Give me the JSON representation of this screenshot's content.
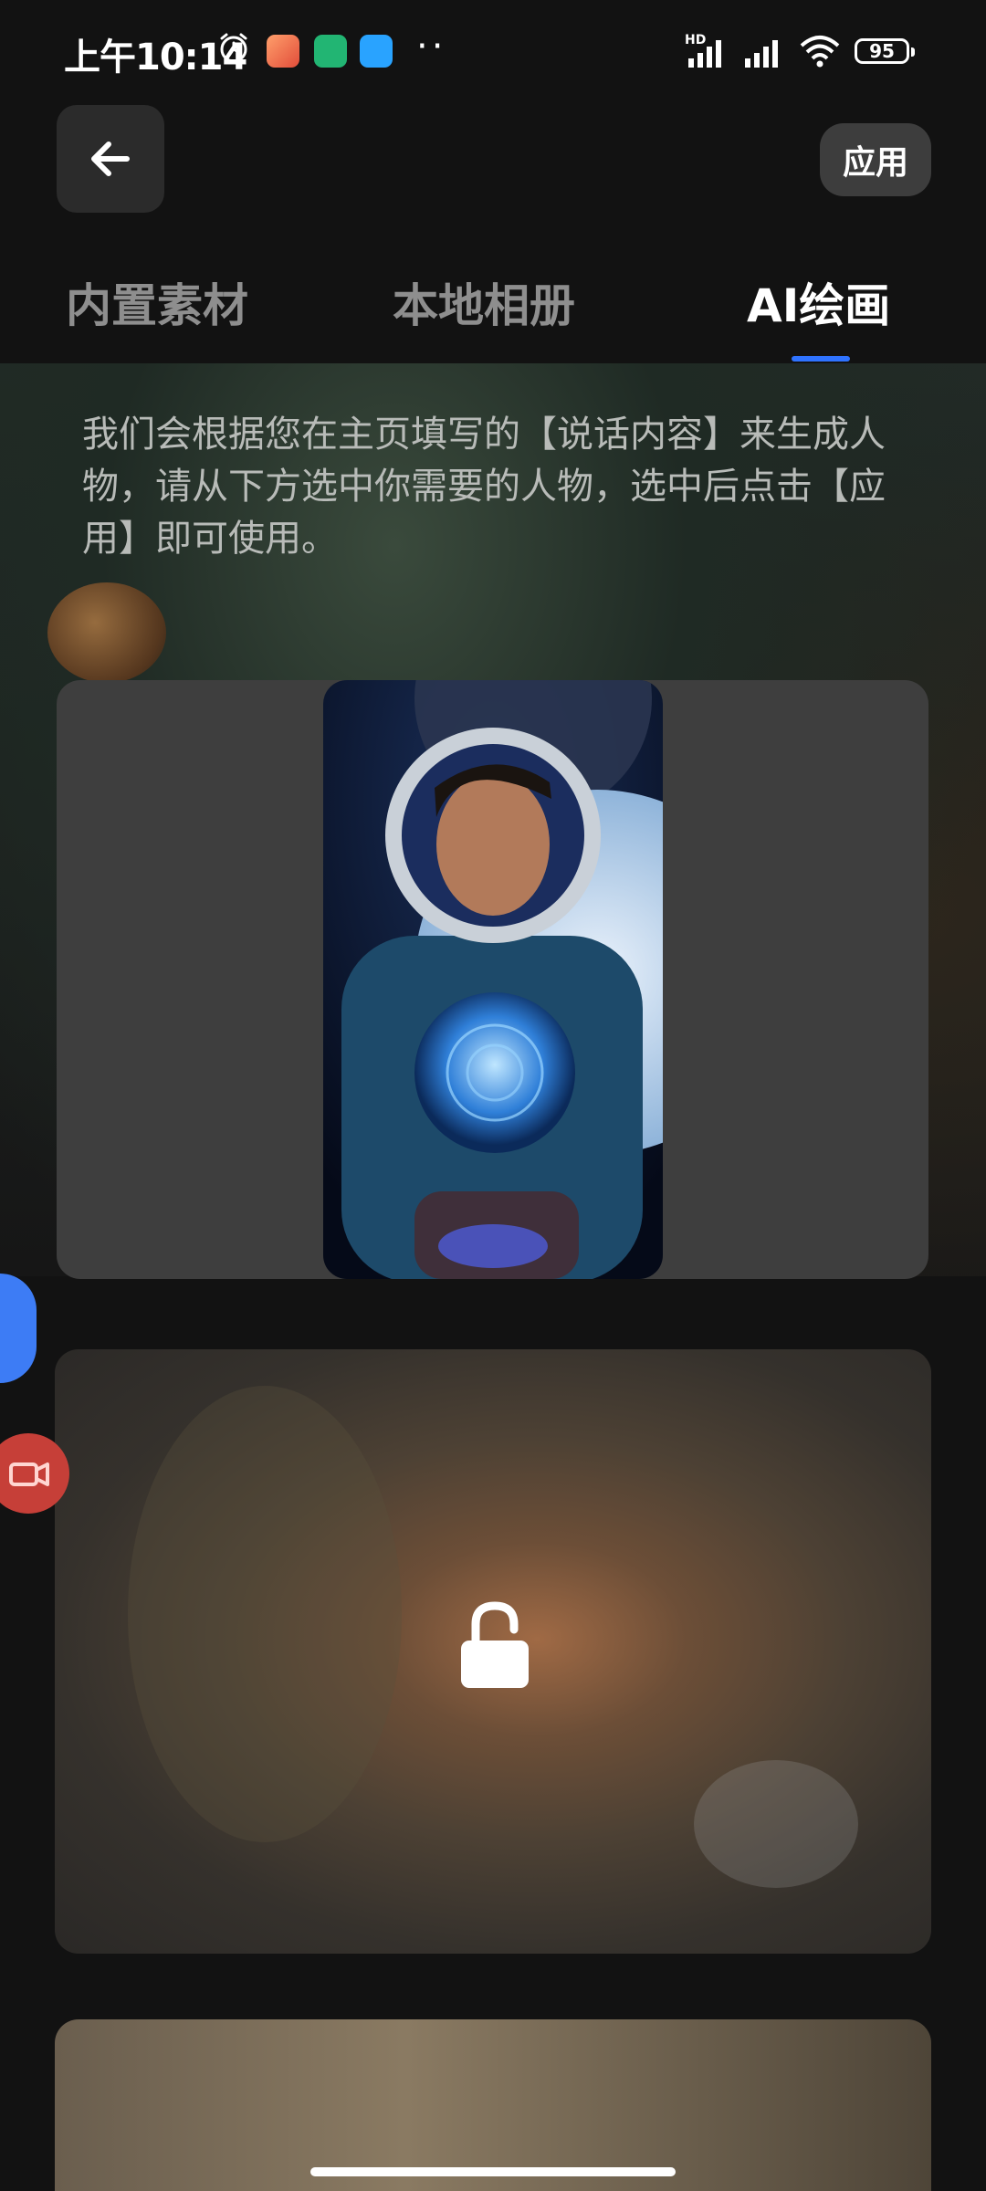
{
  "status_bar": {
    "time": "上午10:14",
    "hd_label": "HD",
    "battery_level": "95",
    "icons": [
      "alarm-icon",
      "app-notification-icon",
      "shield-icon",
      "message-icon",
      "more-dots",
      "signal-hd-icon",
      "signal-icon",
      "wifi-icon",
      "battery-icon"
    ]
  },
  "header": {
    "back_icon": "arrow-left-icon",
    "apply_label": "应用"
  },
  "tabs": [
    {
      "label": "内置素材",
      "active": false
    },
    {
      "label": "本地相册",
      "active": false
    },
    {
      "label": "AI绘画",
      "active": true
    }
  ],
  "colors": {
    "background": "#121212",
    "tab_indicator": "#2f73ff",
    "inactive_tab": "#8e8e8e",
    "card_bg": "#3e3e3e"
  },
  "description": "我们会根据您在主页填写的【说话内容】来生成人物，请从下方选中你需要的人物，选中后点击【应用】即可使用。",
  "cards": [
    {
      "type": "image",
      "subject": "astronaut-portrait"
    },
    {
      "type": "locked",
      "icon": "lock-open-icon"
    },
    {
      "type": "locked-partial"
    }
  ],
  "floating_buttons": [
    "assist-float-icon",
    "screen-record-icon"
  ]
}
